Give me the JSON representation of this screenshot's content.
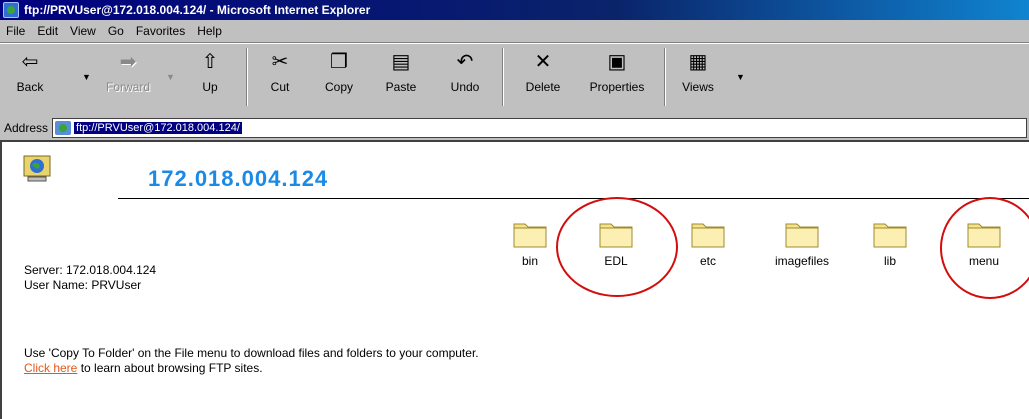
{
  "window": {
    "title": "ftp://PRVUser@172.018.004.124/ - Microsoft Internet Explorer"
  },
  "menu": [
    "File",
    "Edit",
    "View",
    "Go",
    "Favorites",
    "Help"
  ],
  "toolbar": {
    "back": "Back",
    "forward": "Forward",
    "up": "Up",
    "cut": "Cut",
    "copy": "Copy",
    "paste": "Paste",
    "undo": "Undo",
    "delete": "Delete",
    "properties": "Properties",
    "views": "Views"
  },
  "address": {
    "label": "Address",
    "value": "ftp://PRVUser@172.018.004.124/"
  },
  "page": {
    "heading": "172.018.004.124",
    "server_line": "Server: 172.018.004.124",
    "user_line": "User Name: PRVUser",
    "note_part1": "Use 'Copy To Folder' on the File menu to download files and folders to your computer. ",
    "note_link": "Click here",
    "note_part2": " to learn about browsing FTP sites."
  },
  "folders": [
    "bin",
    "EDL",
    "etc",
    "imagefiles",
    "lib",
    "menu"
  ],
  "colors": {
    "heading": "#1b8ae6",
    "link": "#e05a1a",
    "annotation": "#d20d0d",
    "titlebar": "#000080"
  }
}
